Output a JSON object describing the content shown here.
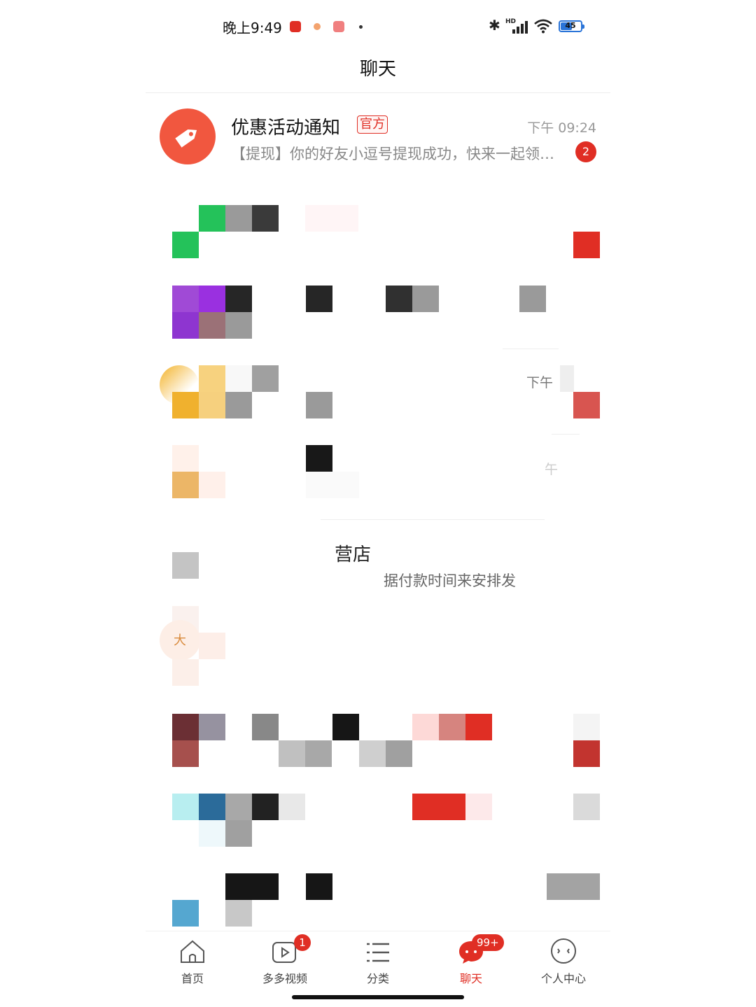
{
  "status_bar": {
    "time": "晚上9:49",
    "battery": "45",
    "network_label": "HD",
    "icons": [
      "pinduoduo-app-icon",
      "notification-icon",
      "app-icon",
      "bluetooth-icon",
      "signal-icon",
      "wifi-icon",
      "battery-icon"
    ]
  },
  "header": {
    "title": "聊天"
  },
  "chats": [
    {
      "name": "优惠活动通知",
      "tag": "官方",
      "time": "下午 09:24",
      "preview": "【提现】你的好友小逗号提现成功，快来一起领现金吧",
      "unread": "2",
      "icon": "tag-icon"
    }
  ],
  "obscured_fragments": {
    "time_fragment": "下午",
    "time_fragment_2": "午",
    "shop_name_fragment": "营店",
    "message_fragment": "据付款时间来安排发",
    "avatar_fragment": "大"
  },
  "nav": {
    "items": [
      {
        "label": "首页",
        "icon": "home-icon"
      },
      {
        "label": "多多视频",
        "icon": "video-icon",
        "badge": "1"
      },
      {
        "label": "分类",
        "icon": "category-icon"
      },
      {
        "label": "聊天",
        "icon": "chat-icon",
        "badge": "99+",
        "active": true
      },
      {
        "label": "个人中心",
        "icon": "profile-icon"
      }
    ]
  },
  "colors": {
    "accent": "#e02e24",
    "avatar_orange": "#f1573f"
  }
}
